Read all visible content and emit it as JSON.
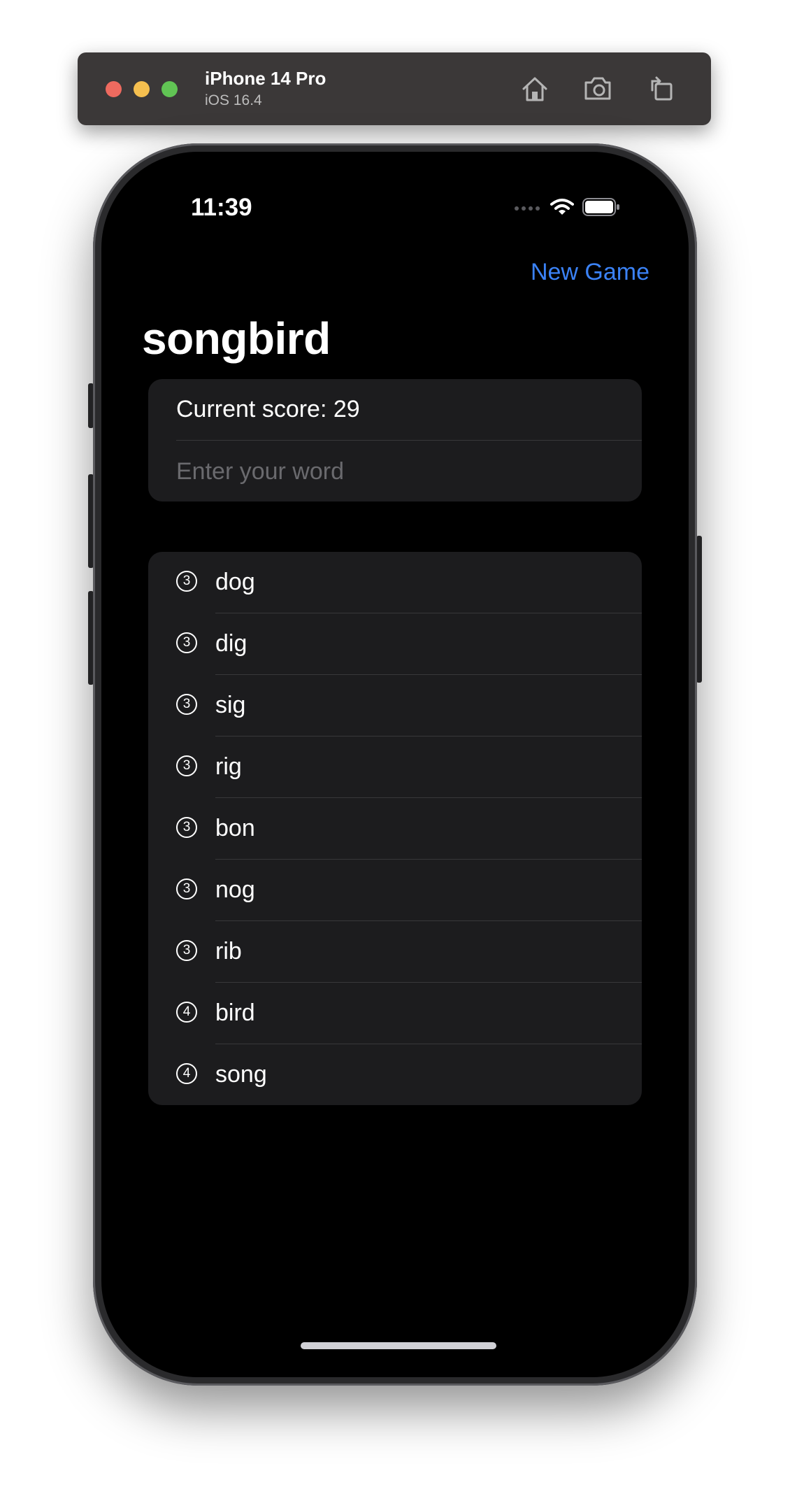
{
  "simulator": {
    "device_name": "iPhone 14 Pro",
    "os_version": "iOS 16.4",
    "buttons": {
      "home": "home-icon",
      "screenshot": "camera-icon",
      "rotate": "rotate-icon"
    }
  },
  "status_bar": {
    "time": "11:39"
  },
  "nav": {
    "new_game_label": "New Game"
  },
  "page": {
    "title": "songbird"
  },
  "score": {
    "text": "Current score: 29"
  },
  "input": {
    "placeholder": "Enter your word",
    "value": ""
  },
  "words": [
    {
      "count": "3",
      "word": "dog"
    },
    {
      "count": "3",
      "word": "dig"
    },
    {
      "count": "3",
      "word": "sig"
    },
    {
      "count": "3",
      "word": "rig"
    },
    {
      "count": "3",
      "word": "bon"
    },
    {
      "count": "3",
      "word": "nog"
    },
    {
      "count": "3",
      "word": "rib"
    },
    {
      "count": "4",
      "word": "bird"
    },
    {
      "count": "4",
      "word": "song"
    }
  ],
  "colors": {
    "accent": "#3b82f6",
    "background": "#000000",
    "card": "#1c1c1e",
    "separator": "#38383a"
  }
}
